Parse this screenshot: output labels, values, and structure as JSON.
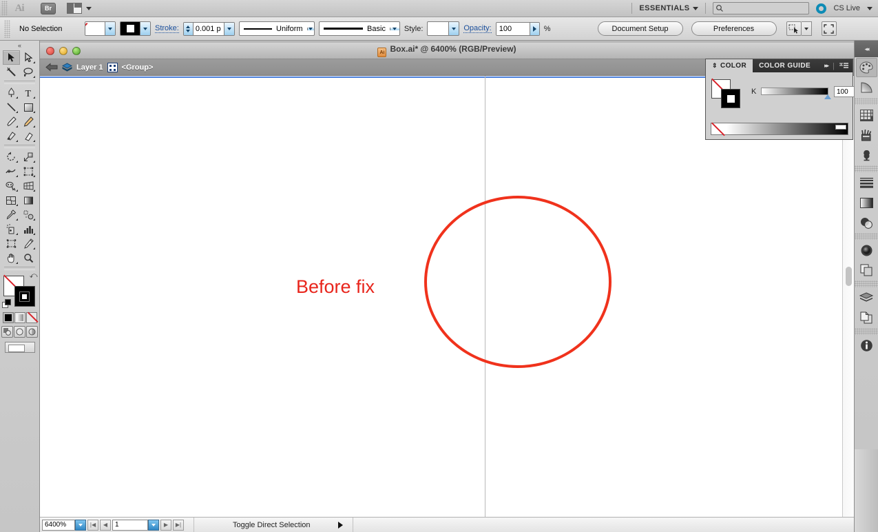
{
  "app": {
    "name": "Adobe Illustrator",
    "logo_text": "Ai",
    "bridge_label": "Br",
    "arrange_icon": "arrange-documents-icon",
    "workspace": "ESSENTIALS",
    "search_placeholder": "",
    "search_value": "",
    "cs_live_label": "CS Live"
  },
  "control_bar": {
    "selection_status": "No Selection",
    "fill_swatch": "none-swatch",
    "stroke_swatch": "black-swatch",
    "stroke_label": "Stroke:",
    "stroke_weight": "0.001 p",
    "variable_width_profile": "Uniform",
    "brush_definition": "Basic",
    "style_label": "Style:",
    "opacity_label": "Opacity:",
    "opacity_value": "100",
    "opacity_unit": "%",
    "document_setup_label": "Document Setup",
    "preferences_label": "Preferences",
    "select_similar_label": "select-similar-objects-icon",
    "align_label": "align-to-selection-icon"
  },
  "toolbar": {
    "collapse_label": "«",
    "tools": [
      {
        "name": "selection-tool",
        "active": true
      },
      {
        "name": "direct-selection-tool",
        "active": false
      },
      {
        "name": "magic-wand-tool",
        "active": false
      },
      {
        "name": "lasso-tool",
        "active": false
      },
      {
        "name": "pen-tool",
        "active": false
      },
      {
        "name": "type-tool",
        "active": false
      },
      {
        "name": "line-segment-tool",
        "active": false
      },
      {
        "name": "rectangle-tool",
        "active": false
      },
      {
        "name": "paintbrush-tool",
        "active": false
      },
      {
        "name": "pencil-tool",
        "active": false
      },
      {
        "name": "blob-brush-tool",
        "active": false
      },
      {
        "name": "eraser-tool",
        "active": false
      },
      {
        "name": "rotate-tool",
        "active": false
      },
      {
        "name": "scale-tool",
        "active": false
      },
      {
        "name": "width-tool",
        "active": false
      },
      {
        "name": "free-transform-tool",
        "active": false
      },
      {
        "name": "shape-builder-tool",
        "active": false
      },
      {
        "name": "perspective-grid-tool",
        "active": false
      },
      {
        "name": "mesh-tool",
        "active": false
      },
      {
        "name": "gradient-tool",
        "active": false
      },
      {
        "name": "eyedropper-tool",
        "active": false
      },
      {
        "name": "blend-tool",
        "active": false
      },
      {
        "name": "symbol-sprayer-tool",
        "active": false
      },
      {
        "name": "column-graph-tool",
        "active": false
      },
      {
        "name": "artboard-tool",
        "active": false
      },
      {
        "name": "slice-tool",
        "active": false
      },
      {
        "name": "hand-tool",
        "active": false
      },
      {
        "name": "zoom-tool",
        "active": false
      }
    ],
    "fill_stroke": {
      "fill": "none",
      "stroke": "black",
      "swap_icon": "swap-fill-stroke-icon",
      "default_icon": "default-fill-stroke-icon"
    },
    "color_modes": [
      {
        "name": "color-mode-button",
        "selected": true
      },
      {
        "name": "gradient-mode-button",
        "selected": false
      },
      {
        "name": "none-mode-button",
        "selected": false
      }
    ],
    "screen_modes": [
      {
        "name": "draw-normal-button"
      },
      {
        "name": "draw-behind-button"
      },
      {
        "name": "draw-inside-button"
      }
    ],
    "screen_mode_label": "change-screen-mode-button"
  },
  "document": {
    "title": "Box.ai* @ 6400% (RGB/Preview)",
    "file_icon": "ai-document-icon",
    "traffic_lights": [
      "close-button",
      "minimize-button",
      "zoom-button"
    ],
    "breadcrumb": {
      "back_icon": "navigate-back-icon",
      "layer_icon": "layer-icon",
      "layer_name": "Layer 1",
      "group_icon": "group-icon",
      "group_name": "<Group>"
    }
  },
  "canvas": {
    "annotation_text": "Before fix",
    "annotation_color": "#e8251c",
    "circle_stroke_color": "#f0321c",
    "guide_color": "#b9b9b9",
    "artboard_edge_color": "#4a7fdc",
    "shapes": [
      {
        "name": "annotation-text",
        "type": "text",
        "value": "Before fix"
      },
      {
        "name": "red-circle-shape",
        "type": "ellipse"
      },
      {
        "name": "vertical-path-segment",
        "type": "line"
      }
    ]
  },
  "status_bar": {
    "zoom_level": "6400%",
    "page_number": "1",
    "status_text": "Toggle Direct Selection",
    "first_page_icon": "first-page-icon",
    "prev_page_icon": "previous-page-icon",
    "next_page_icon": "next-page-icon",
    "last_page_icon": "last-page-icon"
  },
  "color_panel": {
    "tabs": [
      {
        "label": "COLOR",
        "active": true
      },
      {
        "label": "COLOR GUIDE",
        "active": false
      }
    ],
    "expand_icon": "expand-panel-icon",
    "menu_icon": "panel-menu-icon",
    "fill_swatch": "none-swatch",
    "stroke_swatch": "black-swatch",
    "channel_label": "K",
    "channel_value": "100",
    "unit": "%",
    "spectrum_none": "none-color-swatch",
    "spectrum_white": "white-color-swatch"
  },
  "dock": {
    "collapse_icon": "collapse-dock-icon",
    "icons": [
      {
        "name": "color-panel-icon",
        "active": true
      },
      {
        "name": "color-guide-panel-icon",
        "active": false
      },
      {
        "name": "swatches-panel-icon",
        "active": false
      },
      {
        "name": "brushes-panel-icon",
        "active": false
      },
      {
        "name": "symbols-panel-icon",
        "active": false
      },
      {
        "name": "stroke-panel-icon",
        "active": false
      },
      {
        "name": "gradient-panel-icon",
        "active": false
      },
      {
        "name": "transparency-panel-icon",
        "active": false
      },
      {
        "name": "appearance-panel-icon",
        "active": false
      },
      {
        "name": "graphic-styles-panel-icon",
        "active": false
      },
      {
        "name": "layers-panel-icon",
        "active": false
      },
      {
        "name": "artboards-panel-icon",
        "active": false
      },
      {
        "name": "document-info-panel-icon",
        "active": false
      }
    ]
  }
}
